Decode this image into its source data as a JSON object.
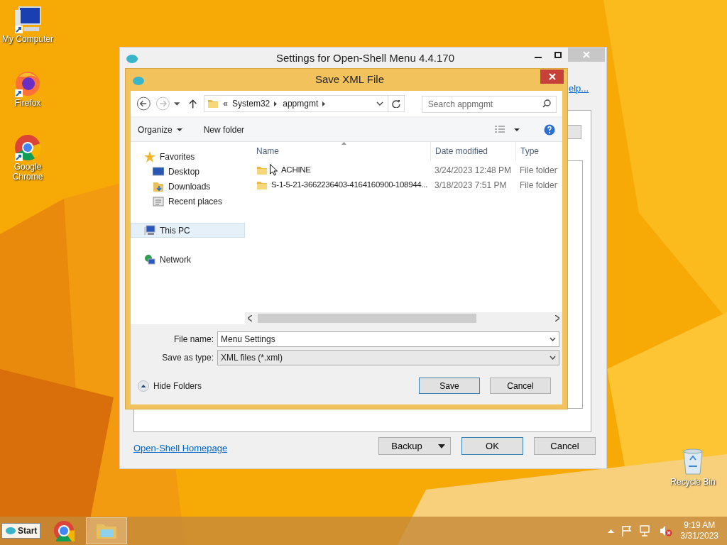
{
  "desktop_icons": [
    {
      "label": "My Computer",
      "kind": "computer"
    },
    {
      "label": "Firefox",
      "kind": "firefox"
    },
    {
      "label": "Google Chrome",
      "kind": "chrome"
    }
  ],
  "settings_window": {
    "title": "Settings for Open-Shell Menu 4.4.170",
    "help_link": "elp...",
    "homepage_link": "Open-Shell Homepage",
    "buttons": [
      {
        "label": "Backup",
        "kind": "split",
        "default": false
      },
      {
        "label": "OK",
        "kind": "plain",
        "default": true
      },
      {
        "label": "Cancel",
        "kind": "plain",
        "default": false
      }
    ]
  },
  "save_dialog": {
    "title": "Save XML File",
    "breadcrumb": [
      "«",
      "System32",
      "appmgmt"
    ],
    "search": {
      "placeholder": "Search appmgmt"
    },
    "toolbar": {
      "organize": "Organize",
      "new_folder": "New folder"
    },
    "nav_pane": [
      {
        "label": "Favorites",
        "kind": "favorites",
        "selected": false,
        "children": [
          {
            "label": "Desktop",
            "kind": "desktop",
            "selected": false
          },
          {
            "label": "Downloads",
            "kind": "downloads",
            "selected": false
          },
          {
            "label": "Recent places",
            "kind": "recent",
            "selected": false
          }
        ]
      },
      {
        "label": "This PC",
        "kind": "pc",
        "selected": true
      },
      {
        "label": "Network",
        "kind": "network",
        "selected": false
      }
    ],
    "columns": [
      "Name",
      "Date modified",
      "Type"
    ],
    "rows": [
      {
        "name": "ACHINE",
        "date": "3/24/2023 12:48 PM",
        "type": "File folder"
      },
      {
        "name": "S-1-5-21-3662236403-4164160900-108944...",
        "date": "3/18/2023 7:51 PM",
        "type": "File folder"
      }
    ],
    "file_name_label": "File name:",
    "file_name": "Menu Settings",
    "type_label": "Save as type:",
    "type_value": "XML files (*.xml)",
    "hide_folders": "Hide Folders",
    "buttons": [
      {
        "label": "Save",
        "default": true
      },
      {
        "label": "Cancel",
        "default": false
      }
    ]
  },
  "recycle_bin": "Recycle Bin",
  "taskbar": {
    "start": "Start",
    "time": "9:19 AM",
    "date": "3/31/2023"
  }
}
